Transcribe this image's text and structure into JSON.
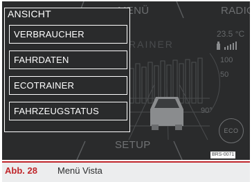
{
  "tabs": {
    "active": "ANSICHT",
    "menu": "MENÜ",
    "radio": "RADIO",
    "setup": "SETUP"
  },
  "menu_items": [
    "VERBRAUCHER",
    "FAHRDATEN",
    "ECOTRAINER",
    "FAHRZEUGSTATUS"
  ],
  "background": {
    "ghost_title": "RAINER",
    "temperature": "23.5 °C",
    "scale_100": "100",
    "scale_50": "50",
    "angle": "90°",
    "eco_label": "ECO"
  },
  "ref_code": "BRS-0071",
  "caption": {
    "number": "Abb. 28",
    "text": "Menü Vista"
  },
  "colors": {
    "screen_bg": "#2a2b2c",
    "accent_red": "#c0262b",
    "foreground": "#ffffff",
    "dim_text": "#6c6e70"
  }
}
